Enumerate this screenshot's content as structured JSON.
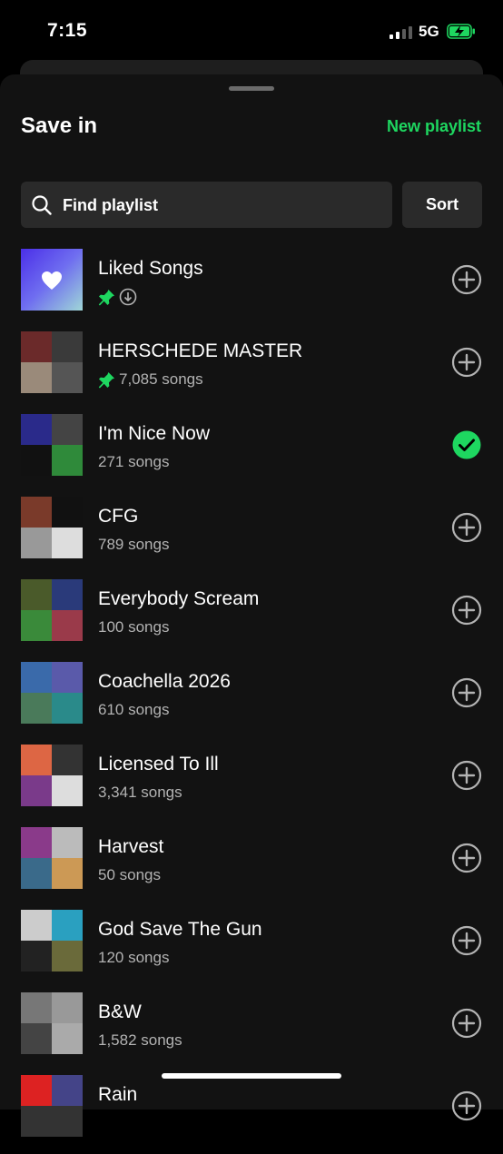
{
  "status_bar": {
    "time": "7:15",
    "network": "5G"
  },
  "sheet": {
    "title": "Save in",
    "new_playlist_label": "New playlist"
  },
  "search": {
    "placeholder": "Find playlist",
    "sort_label": "Sort"
  },
  "colors": {
    "accent": "#1ed760",
    "background": "#121212",
    "field": "#2a2a2a",
    "secondary_text": "#b3b3b3"
  },
  "playlists": [
    {
      "name": "Liked Songs",
      "meta": "",
      "pinned": true,
      "downloaded": true,
      "saved": false
    },
    {
      "name": "HERSCHEDE MASTER",
      "meta": "7,085 songs",
      "pinned": true,
      "downloaded": false,
      "saved": false
    },
    {
      "name": "I'm Nice Now",
      "meta": "271 songs",
      "pinned": false,
      "downloaded": false,
      "saved": true
    },
    {
      "name": "CFG",
      "meta": "789 songs",
      "pinned": false,
      "downloaded": false,
      "saved": false
    },
    {
      "name": "Everybody Scream",
      "meta": "100 songs",
      "pinned": false,
      "downloaded": false,
      "saved": false
    },
    {
      "name": "Coachella 2026",
      "meta": "610 songs",
      "pinned": false,
      "downloaded": false,
      "saved": false
    },
    {
      "name": "Licensed To Ill",
      "meta": "3,341 songs",
      "pinned": false,
      "downloaded": false,
      "saved": false
    },
    {
      "name": "Harvest",
      "meta": "50 songs",
      "pinned": false,
      "downloaded": false,
      "saved": false
    },
    {
      "name": "God Save The Gun",
      "meta": "120 songs",
      "pinned": false,
      "downloaded": false,
      "saved": false
    },
    {
      "name": "B&W",
      "meta": "1,582 songs",
      "pinned": false,
      "downloaded": false,
      "saved": false
    },
    {
      "name": "Rain",
      "meta": "",
      "pinned": false,
      "downloaded": false,
      "saved": false
    }
  ]
}
